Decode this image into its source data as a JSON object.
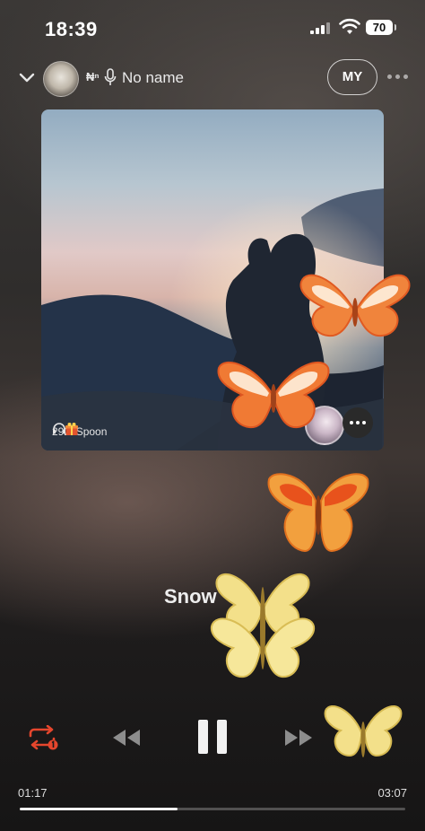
{
  "status_bar": {
    "time": "18:39",
    "battery": "70"
  },
  "header": {
    "badge": "₦ⁿ",
    "name": "No name",
    "my_button": "MY"
  },
  "album": {
    "listeners": "29",
    "gift_label": "22Spoon"
  },
  "song": {
    "title": "Snow"
  },
  "player": {
    "current_time": "01:17",
    "total_time": "03:07",
    "progress": 0.41,
    "repeat_color": "#e5462d"
  }
}
